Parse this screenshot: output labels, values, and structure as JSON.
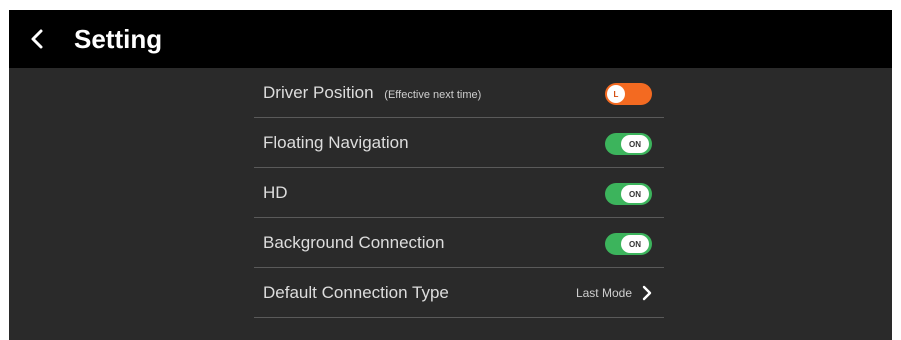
{
  "header": {
    "title": "Setting",
    "back_icon": "chevron-left-icon"
  },
  "colors": {
    "background": "#2a2a2a",
    "header": "#000000",
    "toggle_on": "#3cb45c",
    "toggle_position": "#f36a21"
  },
  "settings": [
    {
      "label": "Driver Position",
      "note": "(Effective next time)",
      "control": "toggle",
      "state": "L"
    },
    {
      "label": "Floating Navigation",
      "control": "toggle",
      "state": "ON"
    },
    {
      "label": "HD",
      "control": "toggle",
      "state": "ON"
    },
    {
      "label": "Background Connection",
      "control": "toggle",
      "state": "ON"
    },
    {
      "label": "Default Connection Type",
      "control": "select",
      "value": "Last Mode",
      "icon": "chevron-right-icon"
    }
  ]
}
